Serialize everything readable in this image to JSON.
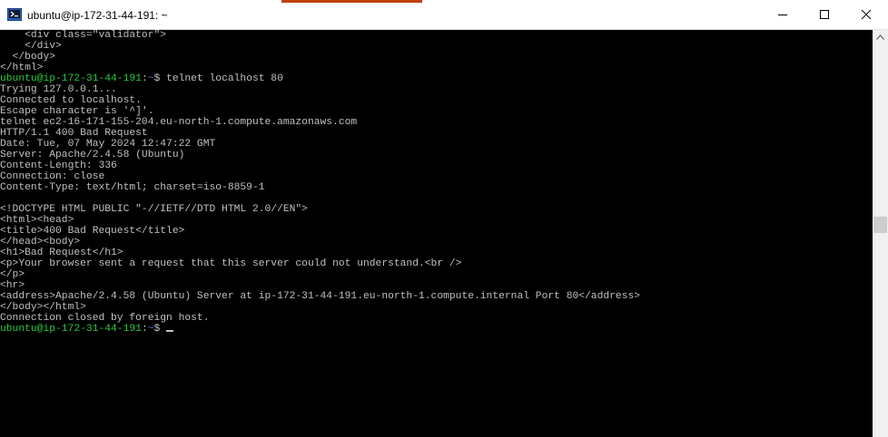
{
  "window": {
    "title": "ubuntu@ip-172-31-44-191: ~",
    "icons": {
      "app": "putty-terminal-icon",
      "minimize": "minimize-icon",
      "maximize": "maximize-icon",
      "close": "close-icon"
    },
    "accent_color": "#c2410c"
  },
  "terminal": {
    "colors": {
      "background": "#000000",
      "text": "#c0c0c0",
      "prompt_user": "#27c93f",
      "prompt_path": "#4e7bd4"
    },
    "lines": [
      "    <div class=\"validator\">",
      "    </div>",
      "  </body>",
      "</html>",
      "",
      "Trying 127.0.0.1...",
      "Connected to localhost.",
      "Escape character is '^]'.",
      "telnet ec2-16-171-155-204.eu-north-1.compute.amazonaws.com",
      "HTTP/1.1 400 Bad Request",
      "Date: Tue, 07 May 2024 12:47:22 GMT",
      "Server: Apache/2.4.58 (Ubuntu)",
      "Content-Length: 336",
      "Connection: close",
      "Content-Type: text/html; charset=iso-8859-1",
      "",
      "<!DOCTYPE HTML PUBLIC \"-//IETF//DTD HTML 2.0//EN\">",
      "<html><head>",
      "<title>400 Bad Request</title>",
      "</head><body>",
      "<h1>Bad Request</h1>",
      "<p>Your browser sent a request that this server could not understand.<br />",
      "</p>",
      "<hr>",
      "<address>Apache/2.4.58 (Ubuntu) Server at ip-172-31-44-191.eu-north-1.compute.internal Port 80</address>",
      "</body></html>",
      "Connection closed by foreign host.",
      ""
    ],
    "prompts": [
      {
        "user_host": "ubuntu@ip-172-31-44-191",
        "separator": ":",
        "path": "~",
        "symbol": "$ ",
        "command": "telnet localhost 80"
      },
      {
        "user_host": "ubuntu@ip-172-31-44-191",
        "separator": ":",
        "path": "~",
        "symbol": "$ ",
        "command": ""
      }
    ]
  }
}
